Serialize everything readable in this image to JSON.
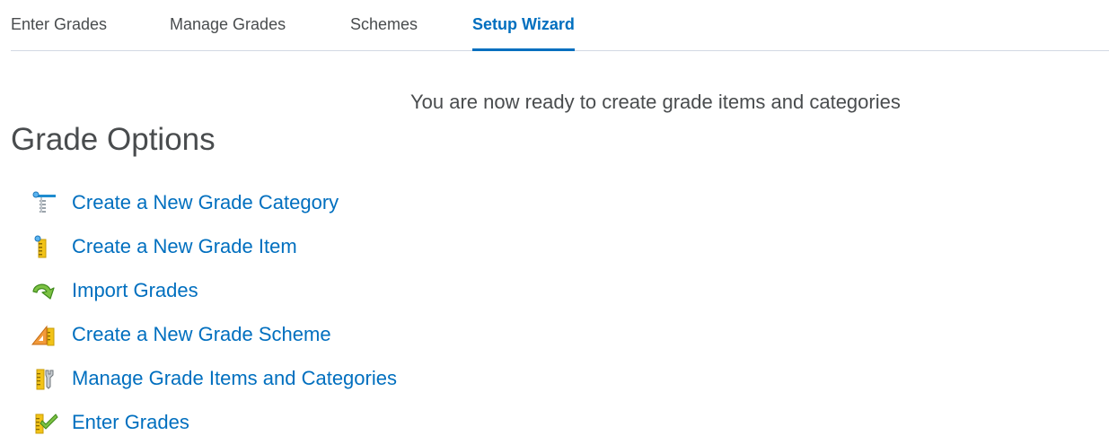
{
  "tabs": [
    {
      "label": "Enter Grades",
      "active": false
    },
    {
      "label": "Manage Grades",
      "active": false
    },
    {
      "label": "Schemes",
      "active": false
    },
    {
      "label": "Setup Wizard",
      "active": true
    }
  ],
  "main": {
    "ready_message": "You are now ready to create grade items and categories",
    "title": "Grade Options",
    "options": [
      {
        "label": "Create a New Grade Category",
        "icon": "grade-category-icon"
      },
      {
        "label": "Create a New Grade Item",
        "icon": "grade-item-icon"
      },
      {
        "label": "Import Grades",
        "icon": "import-arrow-icon"
      },
      {
        "label": "Create a New Grade Scheme",
        "icon": "grade-scheme-icon"
      },
      {
        "label": "Manage Grade Items and Categories",
        "icon": "manage-grades-icon"
      },
      {
        "label": "Enter Grades",
        "icon": "enter-grades-icon"
      }
    ]
  },
  "colors": {
    "link": "#006fbf",
    "text": "#494c4e",
    "divider": "#d3d9e3"
  }
}
